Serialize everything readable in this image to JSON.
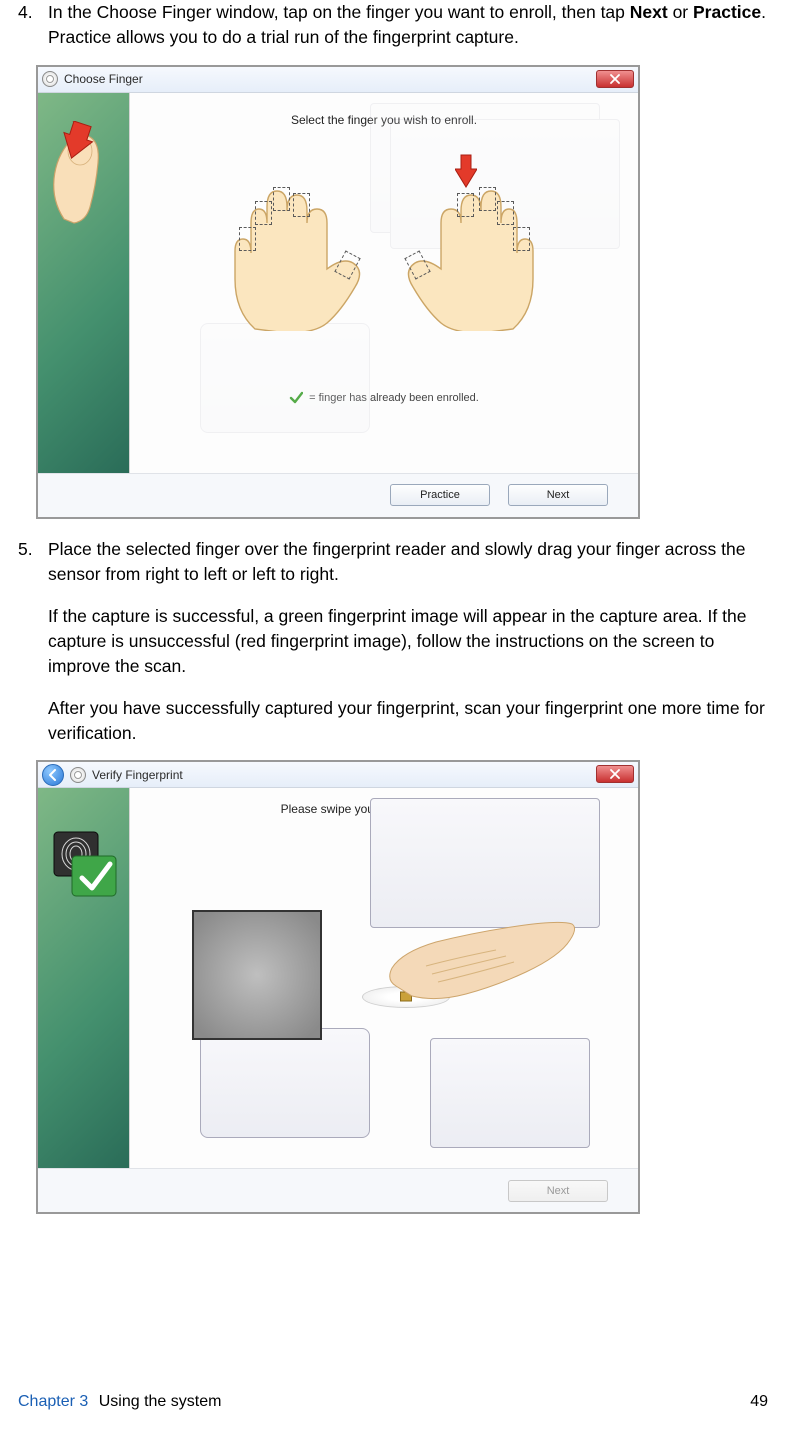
{
  "steps": {
    "four": {
      "num": "4.",
      "text_a": "In the Choose Finger window, tap on the finger you want to enroll, then tap ",
      "bold_a": "Next",
      "text_b": " or ",
      "bold_b": "Practice",
      "text_c": ". Practice allows you to do a trial run of the fingerprint capture."
    },
    "five": {
      "num": "5.",
      "text": "Place the selected finger over the fingerprint reader and slowly drag your finger across the sensor from right to left or left to right."
    }
  },
  "para1": "If the capture is successful, a green fingerprint image will appear in the capture area. If the capture is unsuccessful (red fingerprint image), follow the instructions on the screen to improve the scan.",
  "para2": "After you have successfully captured your fingerprint, scan your fingerprint one more time for verification.",
  "shot1": {
    "title": "Choose Finger",
    "instruction": "Select the finger you wish to enroll.",
    "enrolled_legend": "= finger has already been enrolled.",
    "btn_practice": "Practice",
    "btn_next": "Next"
  },
  "shot2": {
    "title": "Verify Fingerprint",
    "instruction": "Please swipe your finger on the sensor",
    "btn_next": "Next"
  },
  "footer": {
    "chapter_label": "Chapter 3",
    "chapter_title": "Using the system",
    "page": "49"
  }
}
